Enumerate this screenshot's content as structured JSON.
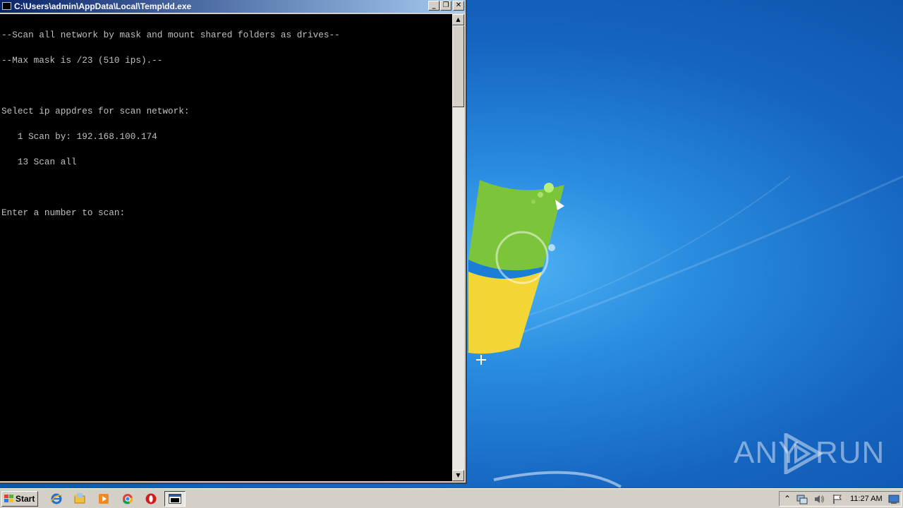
{
  "window": {
    "title": "C:\\Users\\admin\\AppData\\Local\\Temp\\dd.exe",
    "buttons": {
      "minimize": "_",
      "restore": "❐",
      "close": "✕"
    }
  },
  "console": {
    "lines": [
      "--Scan all network by mask and mount shared folders as drives--",
      "--Max mask is /23 (510 ips).--",
      "",
      "Select ip appdres for scan network:",
      "   1 Scan by: 192.168.100.174",
      "   13 Scan all",
      "",
      "Enter a number to scan:"
    ]
  },
  "taskbar": {
    "start_label": "Start",
    "quick_launch": [
      "internet-explorer-icon",
      "explorer-folder-icon",
      "media-player-icon",
      "chrome-icon",
      "opera-icon"
    ],
    "active_task_icon": "console-window-icon",
    "clock": "11:27 AM"
  },
  "watermark": {
    "left": "ANY",
    "right": "RUN"
  }
}
